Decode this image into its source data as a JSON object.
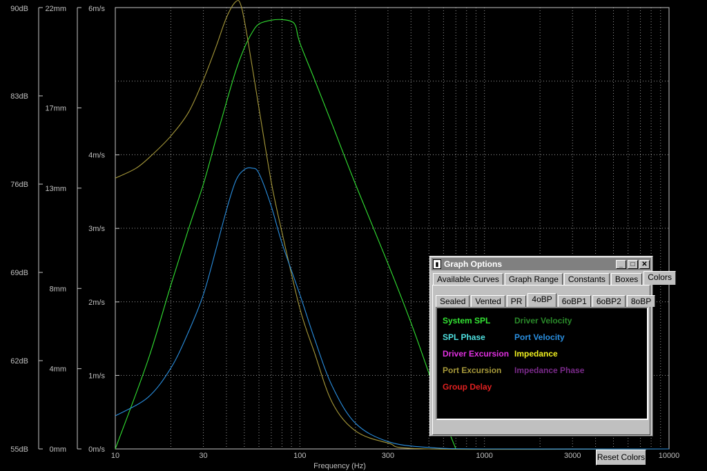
{
  "chart_data": {
    "type": "line",
    "xlabel": "Frequency (Hz)",
    "x_scale": "log",
    "xlim": [
      10,
      10000
    ],
    "x_ticks": [
      "10",
      "30",
      "100",
      "300",
      "1000",
      "3000",
      "10000"
    ],
    "axes": [
      {
        "name": "spl",
        "unit": "dB",
        "ticks": [
          "55dB",
          "62dB",
          "69dB",
          "76dB",
          "83dB",
          "90dB"
        ],
        "range": [
          55,
          90
        ]
      },
      {
        "name": "excursion",
        "unit": "mm",
        "ticks": [
          "0mm",
          "4mm",
          "8mm",
          "13mm",
          "17mm",
          "22mm"
        ],
        "range": [
          0,
          22
        ]
      },
      {
        "name": "velocity",
        "unit": "m/s",
        "ticks": [
          "0m/s",
          "1m/s",
          "2m/s",
          "3m/s",
          "4m/s",
          "6m/s"
        ],
        "range": [
          0,
          6
        ]
      }
    ],
    "grid": true,
    "series": [
      {
        "name": "System SPL",
        "color": "#33e533",
        "axis": "spl",
        "points": [
          [
            10,
            55.0
          ],
          [
            15,
            62.0
          ],
          [
            20,
            68.0
          ],
          [
            25,
            72.5
          ],
          [
            30,
            76.0
          ],
          [
            35,
            79.5
          ],
          [
            40,
            82.5
          ],
          [
            45,
            85.0
          ],
          [
            50,
            86.8
          ],
          [
            55,
            88.0
          ],
          [
            60,
            88.7
          ],
          [
            70,
            89.0
          ],
          [
            80,
            89.05
          ],
          [
            90,
            88.9
          ],
          [
            95,
            88.5
          ],
          [
            100,
            87.2
          ],
          [
            120,
            84.3
          ],
          [
            150,
            80.7
          ],
          [
            200,
            76.0
          ],
          [
            300,
            69.7
          ],
          [
            400,
            65.0
          ],
          [
            500,
            61.0
          ],
          [
            600,
            57.5
          ],
          [
            700,
            55.0
          ]
        ]
      },
      {
        "name": "Port Excursion",
        "color": "#a89a3a",
        "axis": "excursion",
        "points": [
          [
            10,
            13.5
          ],
          [
            13,
            14.0
          ],
          [
            16,
            14.7
          ],
          [
            20,
            15.6
          ],
          [
            25,
            16.8
          ],
          [
            30,
            18.4
          ],
          [
            35,
            20.0
          ],
          [
            40,
            21.5
          ],
          [
            45,
            22.3
          ],
          [
            48,
            22.1
          ],
          [
            52,
            20.5
          ],
          [
            60,
            17.0
          ],
          [
            70,
            13.3
          ],
          [
            80,
            10.8
          ],
          [
            100,
            7.0
          ],
          [
            120,
            4.8
          ],
          [
            150,
            2.3
          ],
          [
            200,
            0.9
          ],
          [
            300,
            0.3
          ],
          [
            500,
            0.0
          ],
          [
            10000,
            0.0
          ]
        ]
      },
      {
        "name": "Port Velocity",
        "color": "#2a8fe0",
        "axis": "velocity",
        "points": [
          [
            10,
            0.45
          ],
          [
            15,
            0.7
          ],
          [
            20,
            1.1
          ],
          [
            25,
            1.6
          ],
          [
            30,
            2.1
          ],
          [
            35,
            2.7
          ],
          [
            40,
            3.25
          ],
          [
            45,
            3.65
          ],
          [
            50,
            3.8
          ],
          [
            55,
            3.82
          ],
          [
            60,
            3.75
          ],
          [
            70,
            3.3
          ],
          [
            80,
            2.8
          ],
          [
            100,
            2.1
          ],
          [
            120,
            1.5
          ],
          [
            150,
            0.85
          ],
          [
            200,
            0.35
          ],
          [
            300,
            0.1
          ],
          [
            500,
            0.02
          ],
          [
            1000,
            0.0
          ],
          [
            10000,
            0.0
          ]
        ]
      }
    ]
  },
  "window": {
    "title": "Graph Options",
    "tabs": [
      "Available Curves",
      "Graph Range",
      "Constants",
      "Boxes",
      "Colors"
    ],
    "active_tab": "Colors",
    "subtabs": [
      "Sealed",
      "Vented",
      "PR",
      "4oBP",
      "6oBP1",
      "6oBP2",
      "8oBP"
    ],
    "active_subtab": "4oBP",
    "colors_left": [
      {
        "label": "System SPL",
        "color": "#33e533"
      },
      {
        "label": "SPL Phase",
        "color": "#4ee0e0"
      },
      {
        "label": "Driver Excursion",
        "color": "#e030e0"
      },
      {
        "label": "Port Excursion",
        "color": "#a89a3a"
      },
      {
        "label": "Group Delay",
        "color": "#e02020"
      }
    ],
    "colors_right": [
      {
        "label": "Driver Velocity",
        "color": "#2a8a2a"
      },
      {
        "label": "Port Velocity",
        "color": "#2a8fe0"
      },
      {
        "label": "Impedance",
        "color": "#f0f020"
      },
      {
        "label": "Impedance Phase",
        "color": "#7a2a8a"
      }
    ],
    "reset_label": "Reset Colors"
  }
}
